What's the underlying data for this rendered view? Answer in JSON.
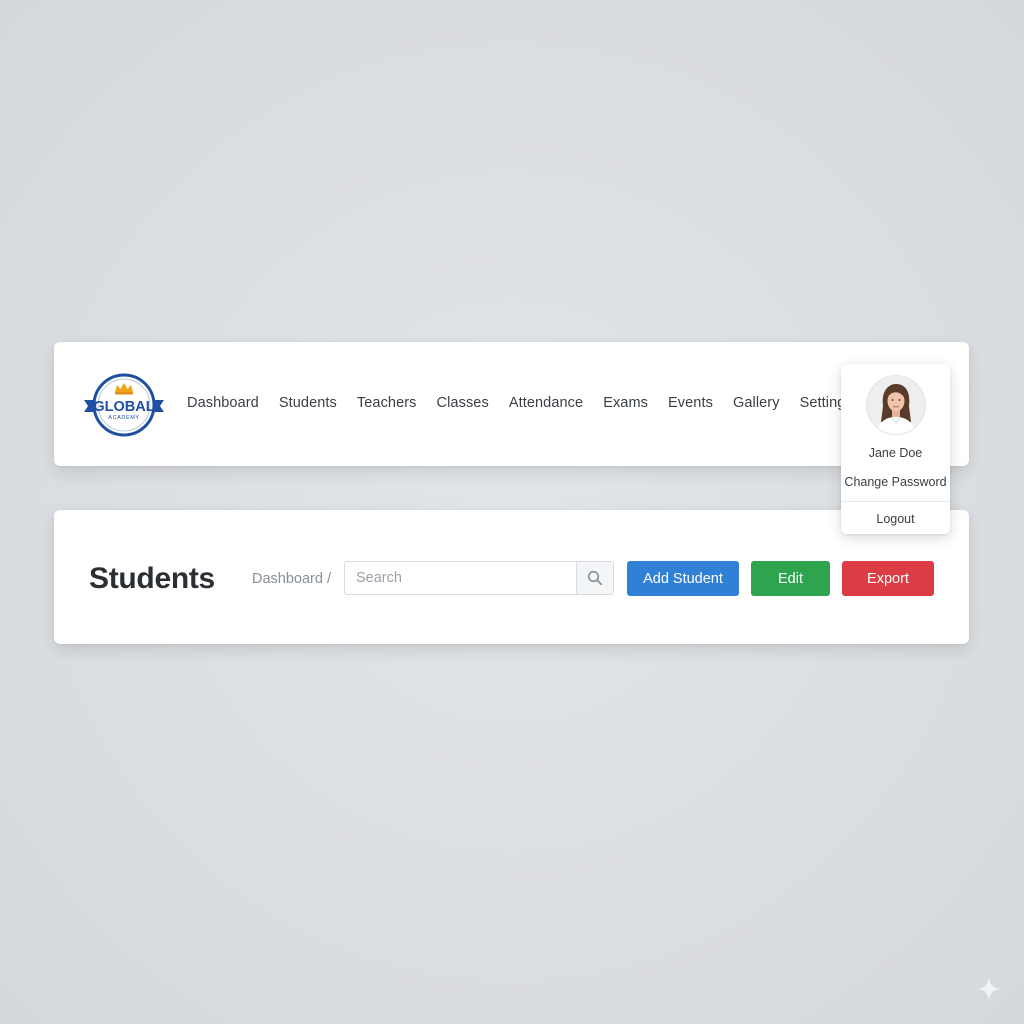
{
  "brand": {
    "logo_line1": "GLOBAL",
    "logo_line2": "ACADEMY",
    "colors": {
      "primary": "#1f4fa3",
      "accent": "#f2a51a"
    }
  },
  "nav": {
    "items": [
      {
        "label": "Dashboard"
      },
      {
        "label": "Students"
      },
      {
        "label": "Teachers"
      },
      {
        "label": "Classes"
      },
      {
        "label": "Attendance"
      },
      {
        "label": "Exams"
      },
      {
        "label": "Events"
      },
      {
        "label": "Gallery"
      },
      {
        "label": "Settings"
      }
    ]
  },
  "profile": {
    "name": "Jane Doe",
    "change_password": "Change Password",
    "logout": "Logout",
    "avatar_icon": "user-avatar"
  },
  "page": {
    "title": "Students",
    "breadcrumb": {
      "parent": "Dashboard",
      "separator": "/"
    },
    "search": {
      "placeholder": "Search",
      "value": "",
      "icon": "search-icon"
    },
    "actions": {
      "add_label": "Add Student",
      "edit_label": "Edit",
      "export_label": "Export"
    },
    "colors": {
      "add": "#2f80d6",
      "edit": "#2ea44f",
      "export": "#dc3d45"
    }
  }
}
